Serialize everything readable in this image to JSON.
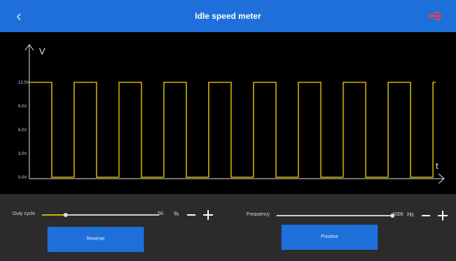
{
  "header": {
    "title": "Idle speed meter",
    "back_icon": "chevron-left-icon",
    "usb_icon": "usb-icon"
  },
  "colors": {
    "header_bg": "#1e6fd9",
    "signal": "#d4b000",
    "scope_bg": "#000000",
    "panel_bg": "#2b2b2b"
  },
  "chart_data": {
    "type": "line",
    "xlabel": "t",
    "ylabel": "V",
    "y_ticks": [
      "12.0V",
      "9.0V",
      "6.0V",
      "3.0V",
      "0.0V"
    ],
    "y_tick_values": [
      12,
      9,
      6,
      3,
      0
    ],
    "ylim": [
      0,
      12
    ],
    "grid": false,
    "series": [
      {
        "pulses": 9,
        "high": 12,
        "low": 0,
        "duty_cycle": 50
      }
    ]
  },
  "duty": {
    "label": "Duty cycle",
    "value": "50",
    "unit": "%",
    "fraction": 0.2
  },
  "frequency": {
    "label": "Frequency",
    "value": "1000",
    "unit": "Hz",
    "fraction": 1.0
  },
  "buttons": {
    "reverse": "Reverse",
    "positive": "Positive"
  }
}
